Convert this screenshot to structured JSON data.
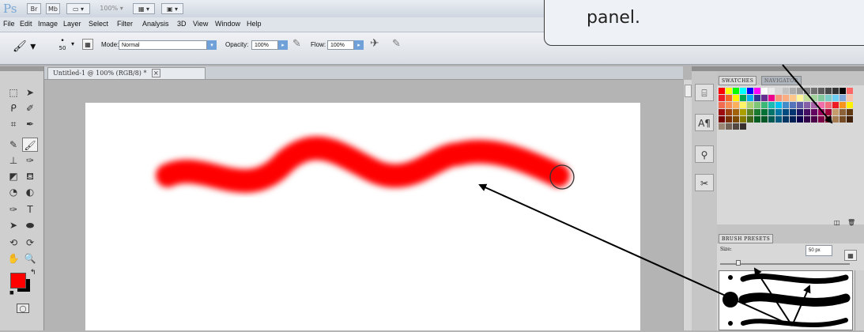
{
  "app": {
    "logo": "Ps",
    "zoom": "100%"
  },
  "menubar": {
    "items": [
      "File",
      "Edit",
      "Image",
      "Layer",
      "Select",
      "Filter",
      "Analysis",
      "3D",
      "View",
      "Window",
      "Help"
    ]
  },
  "options": {
    "brush_size": "50",
    "mode_label": "Mode:",
    "mode_value": "Normal",
    "opacity_label": "Opacity:",
    "opacity_value": "100%",
    "flow_label": "Flow:",
    "flow_value": "100%"
  },
  "document": {
    "tab_title": "Untitled-1 @ 100% (RGB/8) *",
    "close_symbol": "×"
  },
  "callout": {
    "text": "panel."
  },
  "swatches_panel": {
    "tabs": [
      "SWATCHES",
      "NAVIGATOR"
    ],
    "colors": [
      [
        "#ff0000",
        "#ffff00",
        "#00ff00",
        "#00ffff",
        "#0000ff",
        "#ff00ff",
        "#ffffff",
        "#ebebeb",
        "#d6d6d6",
        "#c2c2c2",
        "#adadad",
        "#999999",
        "#858585",
        "#707070",
        "#5c5c5c",
        "#474747",
        "#333333",
        "#000000",
        "#ff6666"
      ],
      [
        "#ee1c24",
        "#f26522",
        "#fff200",
        "#00a651",
        "#00aeef",
        "#2e3192",
        "#662d91",
        "#ec008c",
        "#f7977a",
        "#f9ad81",
        "#fdc68a",
        "#fff79a",
        "#c4df9b",
        "#a2d39c",
        "#82ca9d",
        "#7bcdc8",
        "#6ecff6",
        "#7ea7d8",
        "#f7c0a8"
      ],
      [
        "#f26c4f",
        "#f68e55",
        "#fbaf5c",
        "#fff467",
        "#acd372",
        "#7cc576",
        "#3bb878",
        "#1abbb4",
        "#00bff3",
        "#438cca",
        "#5574b9",
        "#605ca8",
        "#855fa8",
        "#a763a8",
        "#f06ea9",
        "#f26d7d",
        "#ed1c24",
        "#f7941d",
        "#fff200"
      ],
      [
        "#9e0b0f",
        "#a0410d",
        "#a36209",
        "#aba000",
        "#598527",
        "#1a7b30",
        "#007236",
        "#00746b",
        "#0076a3",
        "#004b80",
        "#003471",
        "#1b1464",
        "#440e62",
        "#630460",
        "#9e005d",
        "#9e0039",
        "#c69c6d",
        "#8c6239",
        "#603913"
      ],
      [
        "#790000",
        "#7b2e00",
        "#7d4900",
        "#827b00",
        "#406618",
        "#005e20",
        "#005826",
        "#005952",
        "#005b7f",
        "#003663",
        "#002157",
        "#0d004c",
        "#32004b",
        "#4b0049",
        "#7b0046",
        "#7a0026",
        "#a67c52",
        "#754c24",
        "#42210b"
      ],
      [
        "#998675",
        "#736357",
        "#534741",
        "#362f2d"
      ]
    ]
  },
  "brush_presets_panel": {
    "tab": "BRUSH PRESETS",
    "size_label": "Size:",
    "size_value": "50 px",
    "slider_position": 0.14
  }
}
